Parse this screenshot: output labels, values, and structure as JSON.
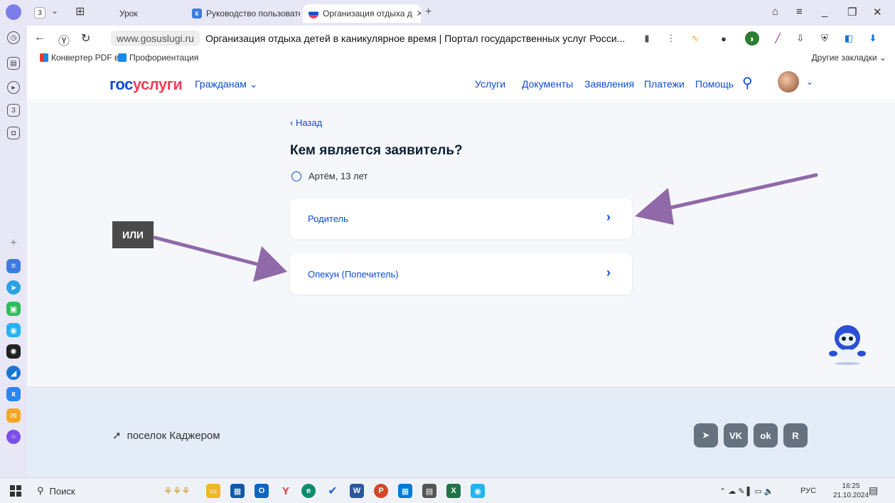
{
  "browser": {
    "tab_count": "3",
    "tabs": [
      {
        "label": "Урок"
      },
      {
        "label": "Руководство пользовате"
      },
      {
        "label": "Организация отдыха д"
      }
    ],
    "url_host": "www.gosuslugi.ru",
    "page_title": "Организация отдыха детей в каникулярное время | Портал государственных услуг Росси...",
    "bookmarks": [
      {
        "label": "Конвертер PDF в"
      },
      {
        "label": "Профориентация"
      }
    ],
    "other_bookmarks": "Другие закладки ⌄"
  },
  "site": {
    "logo_part1": "гос",
    "logo_part2": "услуги",
    "audience_menu": "Гражданам ⌄",
    "nav": [
      "Услуги",
      "Документы",
      "Заявления",
      "Платежи",
      "Помощь"
    ]
  },
  "form": {
    "back_label": "‹ Назад",
    "title": "Кем является заявитель?",
    "child": "Артём, 13 лет",
    "options": [
      {
        "label": "Родитель"
      },
      {
        "label": "Опекун (Попечитель)"
      }
    ]
  },
  "annotation": {
    "or_label": "ИЛИ",
    "color": "#9069a9"
  },
  "footer": {
    "location": "поселок Каджером",
    "social": [
      "telegram-icon",
      "vk-icon",
      "ok-icon",
      "rutube-icon"
    ]
  },
  "taskbar": {
    "search": "Поиск",
    "lang": "РУС",
    "time": "16:25",
    "date": "21.10.2024"
  }
}
